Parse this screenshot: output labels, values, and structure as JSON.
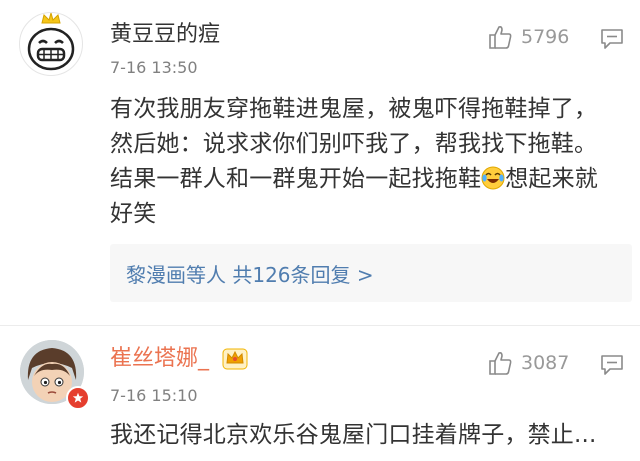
{
  "comments": [
    {
      "author": "黄豆豆的痘",
      "likes": "5796",
      "time": "7-16 13:50",
      "body_parts": [
        "有次我朋友穿拖鞋进鬼屋，被鬼吓得拖鞋掉了，然后她：说求求你们别吓我了，帮我找下拖鞋。结果一群人和一群鬼开始一起找拖鞋",
        "想起来就好笑"
      ],
      "emoji": "laugh-cry-icon",
      "replies_summary": "黎漫画等人  共126条回复 >"
    },
    {
      "author": "崔丝塔娜_",
      "likes": "3087",
      "time": "7-16 15:10",
      "body_parts": [
        "我还记得北京欢乐谷鬼屋门口挂着牌子，禁止...",
        ""
      ],
      "author_color": "#eb7350",
      "vip": "crown-icon"
    }
  ],
  "colors": {
    "link": "#507daf",
    "meta": "#999999",
    "vip_name": "#eb7350"
  }
}
